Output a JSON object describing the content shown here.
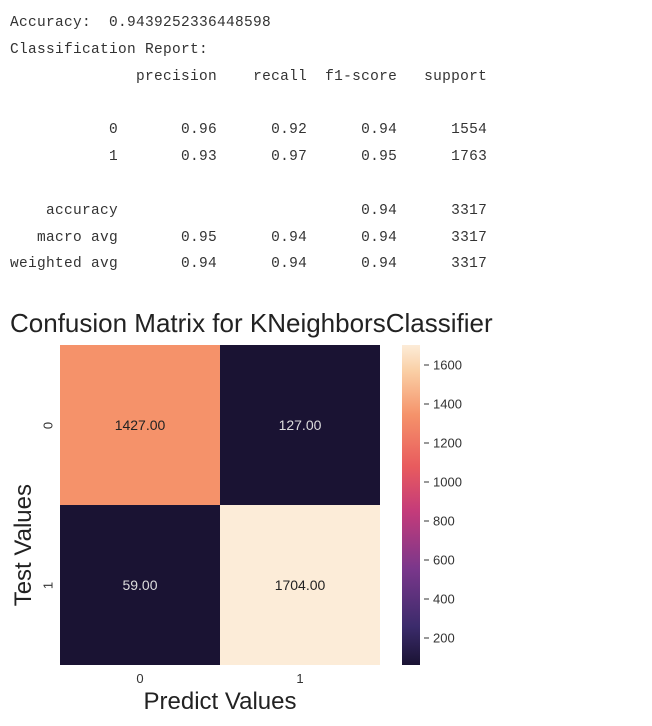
{
  "report": {
    "accuracy_line": "Accuracy:  0.9439252336448598",
    "report_header": "Classification Report:",
    "col_headers": [
      "precision",
      "recall",
      "f1-score",
      "support"
    ],
    "rows": [
      {
        "label": "0",
        "precision": "0.96",
        "recall": "0.92",
        "f1": "0.94",
        "support": "1554"
      },
      {
        "label": "1",
        "precision": "0.93",
        "recall": "0.97",
        "f1": "0.95",
        "support": "1763"
      }
    ],
    "summary": [
      {
        "label": "accuracy",
        "precision": "",
        "recall": "",
        "f1": "0.94",
        "support": "3317"
      },
      {
        "label": "macro avg",
        "precision": "0.95",
        "recall": "0.94",
        "f1": "0.94",
        "support": "3317"
      },
      {
        "label": "weighted avg",
        "precision": "0.94",
        "recall": "0.94",
        "f1": "0.94",
        "support": "3317"
      }
    ]
  },
  "chart_data": {
    "type": "heatmap",
    "title": "Confusion Matrix for KNeighborsClassifier",
    "xlabel": "Predict Values",
    "ylabel": "Test Values",
    "x_categories": [
      "0",
      "1"
    ],
    "y_categories": [
      "0",
      "1"
    ],
    "matrix": [
      [
        1427.0,
        127.0
      ],
      [
        59.0,
        1704.0
      ]
    ],
    "cell_labels": [
      [
        "1427.00",
        "127.00"
      ],
      [
        "59.00",
        "1704.00"
      ]
    ],
    "cell_colors": [
      [
        "#f5926a",
        "#1a1333"
      ],
      [
        "#1a1333",
        "#fcecd8"
      ]
    ],
    "colorbar_ticks": [
      {
        "value": 1600,
        "label": "1600"
      },
      {
        "value": 1400,
        "label": "1400"
      },
      {
        "value": 1200,
        "label": "1200"
      },
      {
        "value": 1000,
        "label": "1000"
      },
      {
        "value": 800,
        "label": "800"
      },
      {
        "value": 600,
        "label": "600"
      },
      {
        "value": 400,
        "label": "400"
      },
      {
        "value": 200,
        "label": "200"
      }
    ],
    "colorbar_range": [
      59,
      1704
    ]
  }
}
